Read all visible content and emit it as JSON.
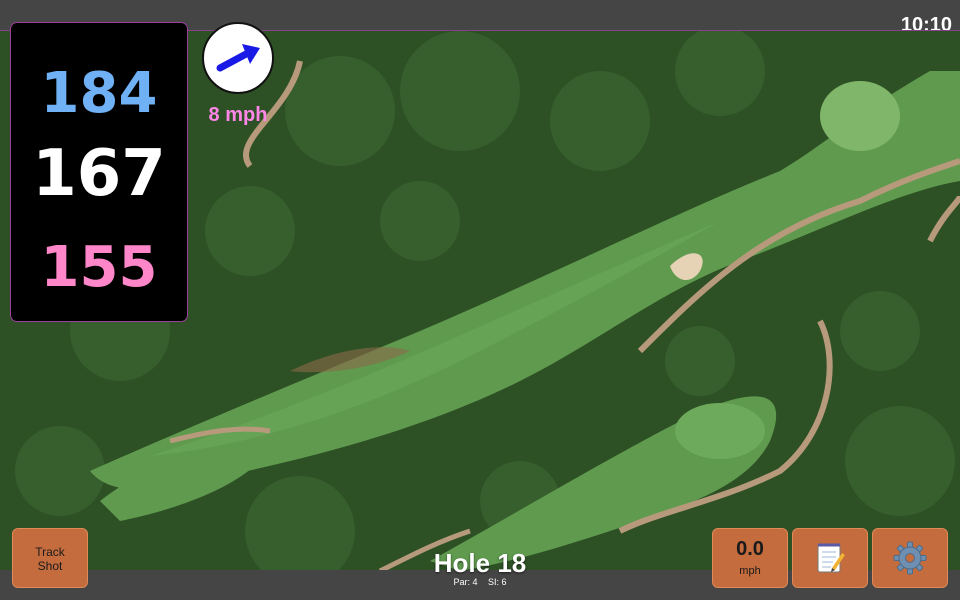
{
  "status": {
    "time": "10:10"
  },
  "distances": {
    "back": "184",
    "middle": "167",
    "front": "155"
  },
  "wind": {
    "speed": "8 mph",
    "direction_icon": "arrow-up-right-icon"
  },
  "hole": {
    "title": "Hole 18",
    "par": "Par: 4",
    "stroke_index": "SI: 6"
  },
  "buttons": {
    "track_shot": "Track\nShot",
    "speed_value": "0.0",
    "speed_unit": "mph",
    "notes_icon": "notepad-icon",
    "settings_icon": "gear-icon"
  },
  "colors": {
    "back_distance": "#6fb1f4",
    "middle_distance": "#ffffff",
    "front_distance": "#ff86c8",
    "wind_speed": "#ff86e6",
    "button": "#c46c3d",
    "panel_border": "#9b3f9b"
  }
}
